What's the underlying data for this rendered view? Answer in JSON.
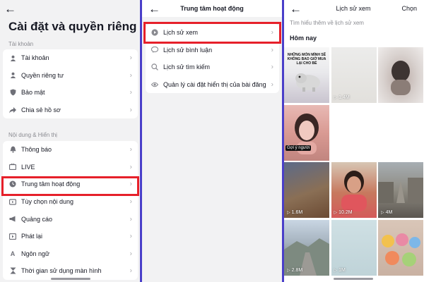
{
  "settings": {
    "title": "Cài đặt và quyền riêng tư",
    "account_section": "Tài khoản",
    "account_items": [
      {
        "label": "Tài khoản",
        "icon": "person-icon"
      },
      {
        "label": "Quyền riêng tư",
        "icon": "lock-icon"
      },
      {
        "label": "Bảo mật",
        "icon": "shield-icon"
      },
      {
        "label": "Chia sẻ hồ sơ",
        "icon": "share-icon"
      }
    ],
    "content_section": "Nội dung & Hiển thị",
    "content_items": [
      {
        "label": "Thông báo",
        "icon": "bell-icon"
      },
      {
        "label": "LIVE",
        "icon": "live-icon"
      },
      {
        "label": "Trung tâm hoạt động",
        "icon": "clock-icon"
      },
      {
        "label": "Tùy chọn nội dung",
        "icon": "video-icon"
      },
      {
        "label": "Quảng cáo",
        "icon": "megaphone-icon"
      },
      {
        "label": "Phát lại",
        "icon": "play-icon"
      },
      {
        "label": "Ngôn ngữ",
        "icon": "language-icon"
      },
      {
        "label": "Thời gian sử dụng màn hình",
        "icon": "hourglass-icon"
      }
    ]
  },
  "activity_center": {
    "title": "Trung tâm hoạt động",
    "items": [
      {
        "label": "Lịch sử xem",
        "icon": "play-circle-icon"
      },
      {
        "label": "Lịch sử bình luận",
        "icon": "comment-icon"
      },
      {
        "label": "Lịch sử tìm kiếm",
        "icon": "search-icon"
      },
      {
        "label": "Quản lý cài đặt hiển thị của bài đăng",
        "icon": "eye-icon"
      }
    ]
  },
  "watch_history": {
    "title": "Lịch sử xem",
    "select_label": "Chọn",
    "hint": "Tìm hiểu thêm về lịch sử xem",
    "section": "Hôm nay",
    "videos": [
      {
        "views": "",
        "caption": "NHỮNG MÓN MÌNH SẼ KHÔNG BAO GIỜ MUA LẠI CHO BÉ",
        "sticker": ""
      },
      {
        "views": "1.4M",
        "caption": "",
        "sticker": ""
      },
      {
        "views": "",
        "caption": "",
        "sticker": ""
      },
      {
        "views": "",
        "caption": "",
        "sticker": "Gợi ý người"
      },
      {
        "views": "",
        "caption": "",
        "sticker": ""
      },
      {
        "views": "",
        "caption": "",
        "sticker": ""
      },
      {
        "views": "1.6M",
        "caption": "",
        "sticker": ""
      },
      {
        "views": "10.2M",
        "caption": "",
        "sticker": ""
      },
      {
        "views": "4M",
        "caption": "",
        "sticker": ""
      },
      {
        "views": "2.8M",
        "caption": "",
        "sticker": ""
      },
      {
        "views": "1M",
        "caption": "",
        "sticker": ""
      },
      {
        "views": "",
        "caption": "",
        "sticker": ""
      }
    ]
  },
  "colors": {
    "highlight": "#e6202a",
    "divider": "#4a3fc9"
  }
}
